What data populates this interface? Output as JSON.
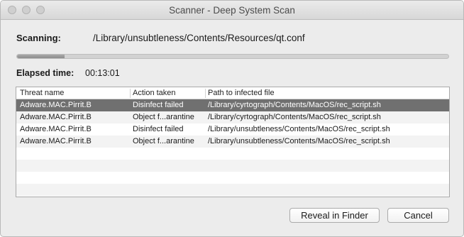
{
  "window": {
    "title": "Scanner - Deep System Scan"
  },
  "scan": {
    "label": "Scanning:",
    "path": "/Library/unsubtleness/Contents/Resources/qt.conf",
    "progress": 0.11
  },
  "elapsed": {
    "label": "Elapsed time:",
    "value": "00:13:01"
  },
  "table": {
    "columns": [
      "Threat name",
      "Action taken",
      "Path to infected file"
    ],
    "rows": [
      [
        "Adware.MAC.Pirrit.B",
        "Disinfect failed",
        "/Library/cyrtograph/Contents/MacOS/rec_script.sh"
      ],
      [
        "Adware.MAC.Pirrit.B",
        "Object f...arantine",
        "/Library/cyrtograph/Contents/MacOS/rec_script.sh"
      ],
      [
        "Adware.MAC.Pirrit.B",
        "Disinfect failed",
        "/Library/unsubtleness/Contents/MacOS/rec_script.sh"
      ],
      [
        "Adware.MAC.Pirrit.B",
        "Object f...arantine",
        "/Library/unsubtleness/Contents/MacOS/rec_script.sh"
      ]
    ],
    "selected_row": 0
  },
  "buttons": {
    "reveal": "Reveal in Finder",
    "cancel": "Cancel"
  }
}
